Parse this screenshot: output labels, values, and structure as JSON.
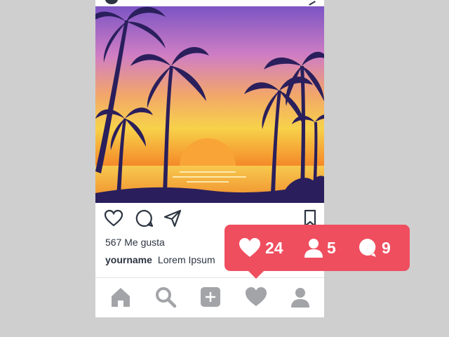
{
  "post": {
    "likes_text": "567 Me gusta",
    "username": "yourname",
    "caption": "Lorem Ipsum"
  },
  "notification": {
    "likes": "24",
    "followers": "5",
    "comments": "9"
  },
  "colors": {
    "background": "#cfcfcf",
    "icon_dark": "#2c3441",
    "nav_icon": "#a2a4a7",
    "badge": "#ef4e5f"
  }
}
